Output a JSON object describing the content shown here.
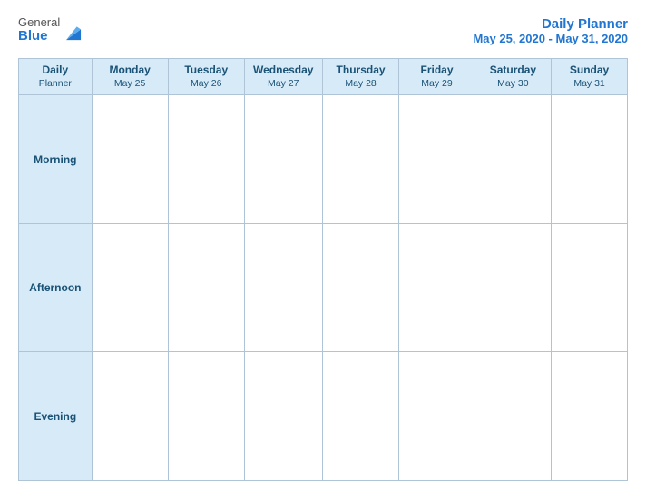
{
  "logo": {
    "general": "General",
    "blue": "Blue"
  },
  "title": {
    "main": "Daily Planner",
    "date_range": "May 25, 2020 - May 31, 2020"
  },
  "header_col": {
    "label_line1": "Daily",
    "label_line2": "Planner"
  },
  "days": [
    {
      "name": "Monday",
      "date": "May 25"
    },
    {
      "name": "Tuesday",
      "date": "May 26"
    },
    {
      "name": "Wednesday",
      "date": "May 27"
    },
    {
      "name": "Thursday",
      "date": "May 28"
    },
    {
      "name": "Friday",
      "date": "May 29"
    },
    {
      "name": "Saturday",
      "date": "May 30"
    },
    {
      "name": "Sunday",
      "date": "May 31"
    }
  ],
  "rows": [
    {
      "label": "Morning"
    },
    {
      "label": "Afternoon"
    },
    {
      "label": "Evening"
    }
  ]
}
